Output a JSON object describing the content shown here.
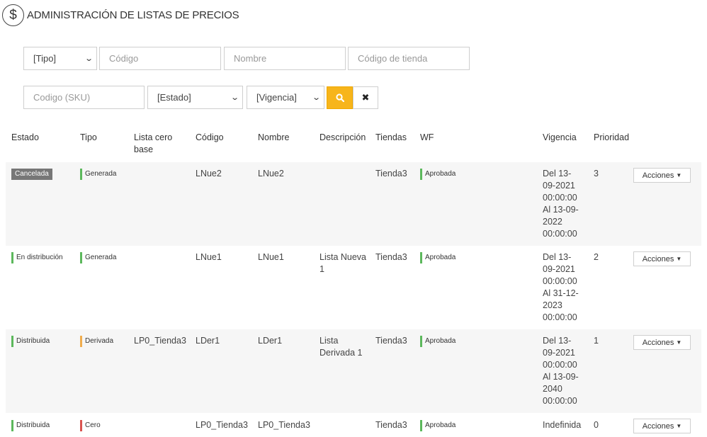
{
  "header": {
    "title": "ADMINISTRACIÓN DE LISTAS DE PRECIOS",
    "icon": "dollar-icon"
  },
  "filters": {
    "tipo": "[Tipo]",
    "codigo": "Código",
    "nombre": "Nombre",
    "codigo_tienda": "Código de tienda",
    "sku": "Codigo (SKU)",
    "estado": "[Estado]",
    "vigencia": "[Vigencia]"
  },
  "colors": {
    "accent": "#f7b51b",
    "green": "#5cb85c",
    "orange": "#f0ad4e",
    "red": "#d9534f",
    "gray_badge": "#777777"
  },
  "table": {
    "headers": {
      "estado": "Estado",
      "tipo": "Tipo",
      "lista_cero_base": "Lista cero base",
      "codigo": "Código",
      "nombre": "Nombre",
      "descripcion": "Descripción",
      "tiendas": "Tiendas",
      "wf": "WF",
      "vigencia": "Vigencia",
      "prioridad": "Prioridad"
    },
    "rows": [
      {
        "estado": "Cancelada",
        "tipo": "Generada",
        "lista_cero_base": "",
        "codigo": "LNue2",
        "nombre": "LNue2",
        "descripcion": "",
        "tiendas": "Tienda3",
        "wf": "Aprobada",
        "vigencia": "Del 13-\n09-2021\n00:00:00\nAl 13-09-\n2022\n00:00:00",
        "prioridad": "3",
        "acciones": "Acciones"
      },
      {
        "estado": "En distribución",
        "tipo": "Generada",
        "lista_cero_base": "",
        "codigo": "LNue1",
        "nombre": "LNue1",
        "descripcion": "Lista Nueva\n1",
        "tiendas": "Tienda3",
        "wf": "Aprobada",
        "vigencia": "Del 13-\n09-2021\n00:00:00\nAl 31-12-\n2023\n00:00:00",
        "prioridad": "2",
        "acciones": "Acciones"
      },
      {
        "estado": "Distribuida",
        "tipo": "Derivada",
        "lista_cero_base": "LP0_Tienda3",
        "codigo": "LDer1",
        "nombre": "LDer1",
        "descripcion": "Lista\nDerivada 1",
        "tiendas": "Tienda3",
        "wf": "Aprobada",
        "vigencia": "Del 13-\n09-2021\n00:00:00\nAl 13-09-\n2040\n00:00:00",
        "prioridad": "1",
        "acciones": "Acciones"
      },
      {
        "estado": "Distribuida",
        "tipo": "Cero",
        "lista_cero_base": "",
        "codigo": "LP0_Tienda3",
        "nombre": "LP0_Tienda3",
        "descripcion": "",
        "tiendas": "Tienda3",
        "wf": "Aprobada",
        "vigencia": "Indefinida",
        "prioridad": "0",
        "acciones": "Acciones"
      }
    ]
  }
}
